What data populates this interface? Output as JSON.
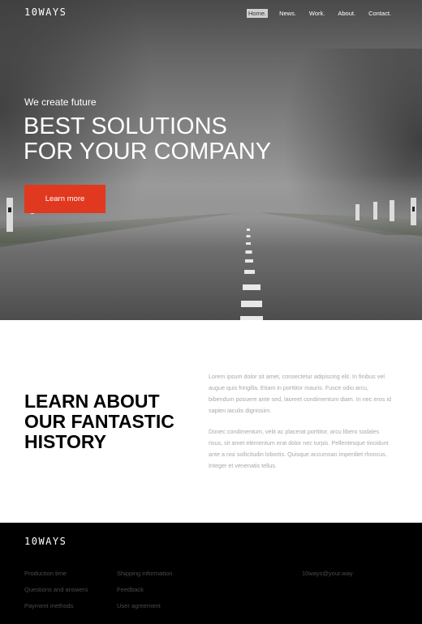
{
  "header": {
    "logo": "10WAYS",
    "nav": [
      {
        "label": "Home.",
        "active": true
      },
      {
        "label": "News.",
        "active": false
      },
      {
        "label": "Work.",
        "active": false
      },
      {
        "label": "About.",
        "active": false
      },
      {
        "label": "Contact.",
        "active": false
      }
    ]
  },
  "hero": {
    "tagline": "We create future",
    "headline_line1": "BEST SOLUTIONS",
    "headline_line2": "FOR YOUR COMPANY",
    "cta_label": "Learn more"
  },
  "about": {
    "title_line1": "LEARN ABOUT",
    "title_line2": "OUR FANTASTIC",
    "title_line3": "HISTORY",
    "paragraph1": "Lorem ipsum dolor sit amet, consectetur adipiscing elit. In finibus vel augue quis fringilla. Etiam in porttitor mauris. Fusce odio arcu, bibendum posuere ante sed, laoreet condimentum diam. In nec eros id sapien iaculis dignissim.",
    "paragraph2": "Donec condimentum, velit ac placerat porttitor, arcu libero sodales risus, sit amet elementum erat dolor nec turpis. Pellentesque tincidunt ante a nisi sollicitudin lobortis. Quisque accumsan imperdiet rhoncus. Integer et venenatis tellus."
  },
  "footer": {
    "logo": "10WAYS",
    "col1": [
      "Production time",
      "Questions and answers",
      "Payment methods"
    ],
    "col2": [
      "Shipping information",
      "Feedback",
      "User agreement"
    ],
    "email": "10ways@your.way"
  },
  "colors": {
    "accent": "#e0391f",
    "footer_bg": "#000000",
    "body_text": "#a8a8a8"
  }
}
